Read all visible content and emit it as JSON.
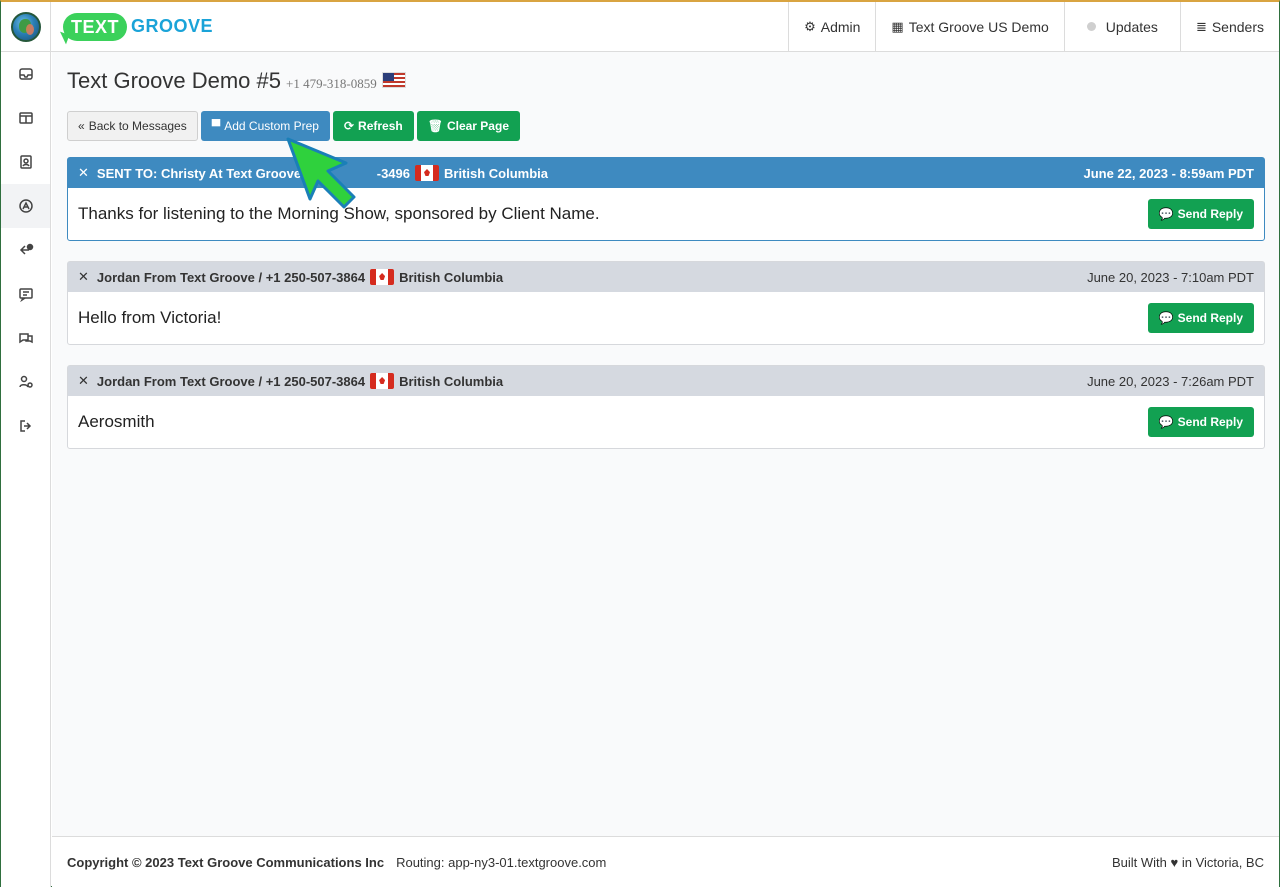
{
  "topbar": {
    "logo_text": "TEXT",
    "logo_word": "GROOVE",
    "nav": [
      {
        "label": "Admin",
        "icon": "gear-icon"
      },
      {
        "label": "Text Groove US Demo",
        "icon": "building-icon"
      },
      {
        "label": "Updates",
        "icon": "dot-icon"
      },
      {
        "label": "Senders",
        "icon": "stack-icon"
      }
    ]
  },
  "sidebar": {
    "items": [
      {
        "name": "inbox-icon"
      },
      {
        "name": "layout-icon"
      },
      {
        "name": "contacts-icon"
      },
      {
        "name": "app-icon"
      },
      {
        "name": "reply-time-icon"
      },
      {
        "name": "message-icon"
      },
      {
        "name": "chat-icon"
      },
      {
        "name": "user-settings-icon"
      },
      {
        "name": "logout-icon"
      }
    ]
  },
  "page": {
    "title": "Text Groove Demo #5",
    "phone": "+1 479-318-0859"
  },
  "toolbar": {
    "back_label": "Back to Messages",
    "add_label": "Add Custom Prep",
    "refresh_label": "Refresh",
    "clear_label": "Clear Page"
  },
  "messages": [
    {
      "sender": "SENT TO: Christy At Text Groove / +1",
      "sender_tail": "-3496",
      "region": "British Columbia",
      "date": "June 22, 2023 - 8:59am PDT",
      "body": "Thanks for listening to the Morning Show, sponsored by Client Name.",
      "reply_label": "Send Reply"
    },
    {
      "sender": "Jordan From Text Groove / +1 250-507-3864",
      "region": "British Columbia",
      "date": "June 20, 2023 - 7:10am PDT",
      "body": "Hello from Victoria!",
      "reply_label": "Send Reply"
    },
    {
      "sender": "Jordan From Text Groove / +1 250-507-3864",
      "region": "British Columbia",
      "date": "June 20, 2023 - 7:26am PDT",
      "body": "Aerosmith",
      "reply_label": "Send Reply"
    }
  ],
  "footer": {
    "copyright": "Copyright © 2023 Text Groove Communications Inc",
    "routing": "Routing: app-ny3-01.textgroove.com",
    "built_prefix": "Built With",
    "built_suffix": "in Victoria, BC"
  },
  "colors": {
    "primary_blue": "#3e8ac0",
    "action_green": "#12a152",
    "logo_green": "#3bd15b",
    "logo_blue": "#1aa3d8"
  }
}
